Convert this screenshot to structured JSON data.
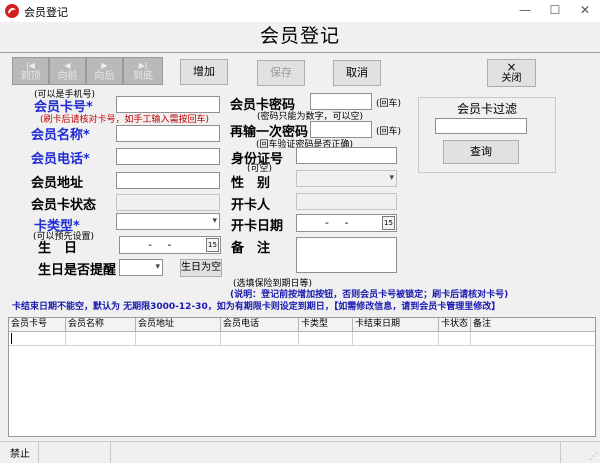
{
  "window": {
    "title": "会员登记",
    "controls": [
      "minimize-icon",
      "maximize-icon",
      "close-icon"
    ]
  },
  "header": {
    "title": "会员登记"
  },
  "toolbar": {
    "nav": [
      {
        "label": "到顶",
        "icon": "skip-first-icon"
      },
      {
        "label": "向前",
        "icon": "prev-icon"
      },
      {
        "label": "向后",
        "icon": "next-icon"
      },
      {
        "label": "到底",
        "icon": "skip-last-icon"
      }
    ],
    "add_label": "增加",
    "save_label": "保存",
    "cancel_label": "取消",
    "close_label": "关闭",
    "close_glyph": "×"
  },
  "form": {
    "phone_hint": "(可以是手机号)",
    "card_no_label": "会员卡号",
    "card_no_hint": "(刷卡后请核对卡号，如手工输入需按回车)",
    "name_label": "会员名称",
    "tel_label": "会员电话",
    "address_label": "会员地址",
    "card_status_label": "会员卡状态",
    "card_type_label": "卡类型",
    "card_type_hint": "(可以预先设置)",
    "birthday_label": "生　日",
    "birthday_value": "- -",
    "birthday_remind_label": "生日是否提醒",
    "birthday_empty_button": "生日为空",
    "password_label": "会员卡密码",
    "password_enter_hint": "(回车)",
    "password_hint": "(密码只能为数字，可以空)",
    "password2_label": "再输一次密码",
    "password2_enter_hint": "(回车)",
    "password2_hint": "(回车验证密码是否正确)",
    "id_label": "身份证号",
    "id_hint": "(可空)",
    "gender_label": "性　别",
    "opener_label": "开卡人",
    "open_date_label": "开卡日期",
    "open_date_value": "- -",
    "remark_label": "备　注",
    "required_star": "*"
  },
  "filter": {
    "title": "会员卡过滤",
    "query_label": "查询"
  },
  "notes": {
    "warranty": "(选填保险到期日等)",
    "instruction": "(说明：登记前按增加按钮，否则会员卡号被锁定；刷卡后请核对卡号)",
    "expiry": "卡结束日期不能空，默认为 无期限3000-12-30，如为有期限卡则设定到期日，【如需修改信息，请到会员卡管理里修改】"
  },
  "grid": {
    "columns": [
      "会员卡号",
      "会员名称",
      "会员地址",
      "会员电话",
      "卡类型",
      "卡结束日期",
      "卡状态",
      "备注"
    ]
  },
  "status": {
    "text": "禁止"
  }
}
